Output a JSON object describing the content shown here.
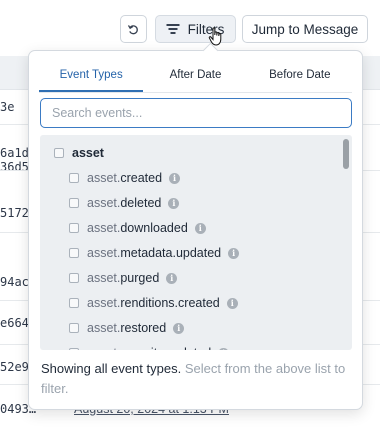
{
  "toolbar": {
    "filters_label": "Filters",
    "jump_label": "Jump to Message",
    "refresh_icon": "refresh-icon",
    "filter_icon": "filter-icon"
  },
  "background": {
    "ids": [
      "3e",
      "6a1d",
      "36d5",
      "5172",
      "94ac",
      "e664",
      "52e9",
      "0493…"
    ],
    "date": "August 20, 2024 at 1:13 PM"
  },
  "popover": {
    "tabs": [
      {
        "label": "Event Types",
        "active": true
      },
      {
        "label": "After Date",
        "active": false
      },
      {
        "label": "Before Date",
        "active": false
      }
    ],
    "search": {
      "placeholder": "Search events...",
      "value": ""
    },
    "group": "asset",
    "events": [
      {
        "prefix": "asset.",
        "name": "created"
      },
      {
        "prefix": "asset.",
        "name": "deleted"
      },
      {
        "prefix": "asset.",
        "name": "downloaded"
      },
      {
        "prefix": "asset.",
        "name": "metadata.updated"
      },
      {
        "prefix": "asset.",
        "name": "purged"
      },
      {
        "prefix": "asset.",
        "name": "renditions.created"
      },
      {
        "prefix": "asset.",
        "name": "restored"
      },
      {
        "prefix": "asset.",
        "name": "security.updated"
      }
    ],
    "footer_strong": "Showing all event types.",
    "footer_hint": "Select from the above list to filter."
  },
  "colors": {
    "accent": "#2f6fb3",
    "list_bg": "#eceff2"
  }
}
